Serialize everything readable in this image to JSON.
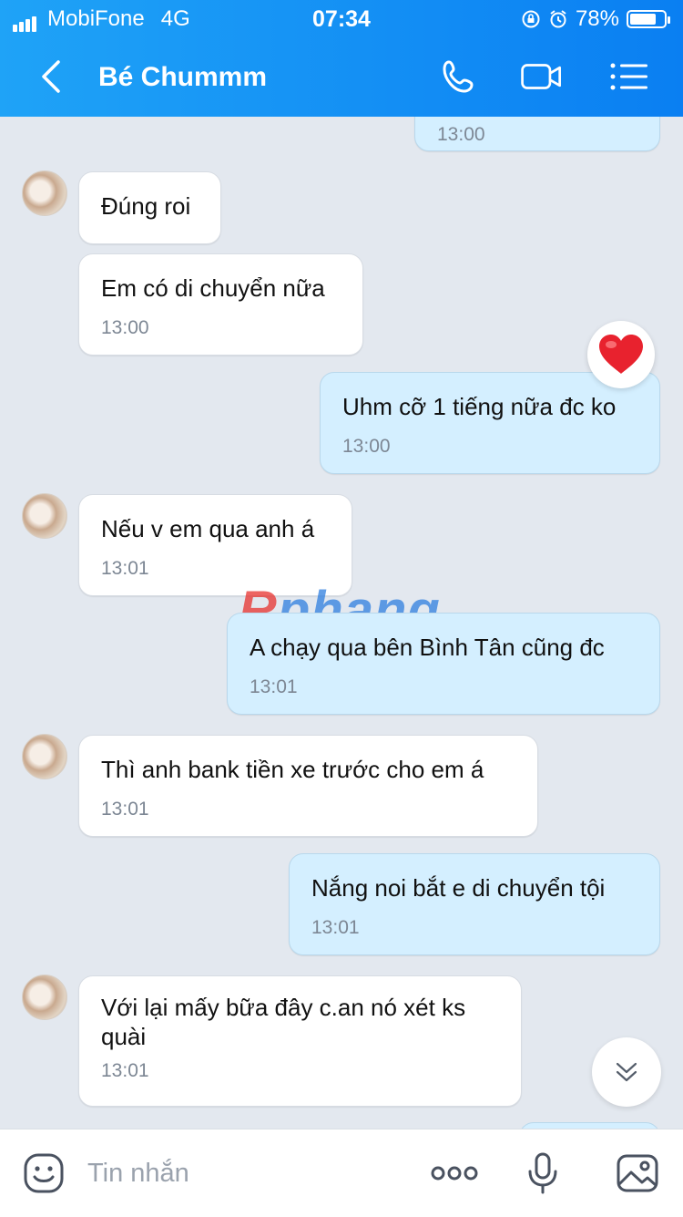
{
  "status": {
    "carrier": "MobiFone",
    "network": "4G",
    "time": "07:34",
    "battery": "78%",
    "battery_level": 0.78
  },
  "header": {
    "title": "Bé Chummm"
  },
  "messages": [
    {
      "dir": "out",
      "time": "13:00"
    },
    {
      "dir": "in",
      "text": "Đúng roi"
    },
    {
      "dir": "in",
      "text": "Em có di chuyển nữa",
      "time": "13:00"
    },
    {
      "dir": "out",
      "text": "Uhm cỡ 1 tiếng nữa đc ko",
      "time": "13:00",
      "reaction": "heart"
    },
    {
      "dir": "in",
      "text": "Nếu v em qua anh á",
      "time": "13:01"
    },
    {
      "dir": "out",
      "text": "A chạy qua bên Bình Tân cũng đc",
      "time": "13:01"
    },
    {
      "dir": "in",
      "text": "Thì anh bank tiền xe trước cho em á",
      "time": "13:01"
    },
    {
      "dir": "out",
      "text": "Nắng noi bắt e di chuyển tội",
      "time": "13:01"
    },
    {
      "dir": "in",
      "text": "Với lại mấy bữa đây c.an nó xét ks quài",
      "time": "13:01"
    }
  ],
  "watermark": "Rphang",
  "input": {
    "placeholder": "Tin nhắn"
  },
  "colors": {
    "header": "#0a7ff2",
    "outgoing": "#d4efff",
    "incoming": "#ffffff",
    "background": "#e3e8ef"
  }
}
